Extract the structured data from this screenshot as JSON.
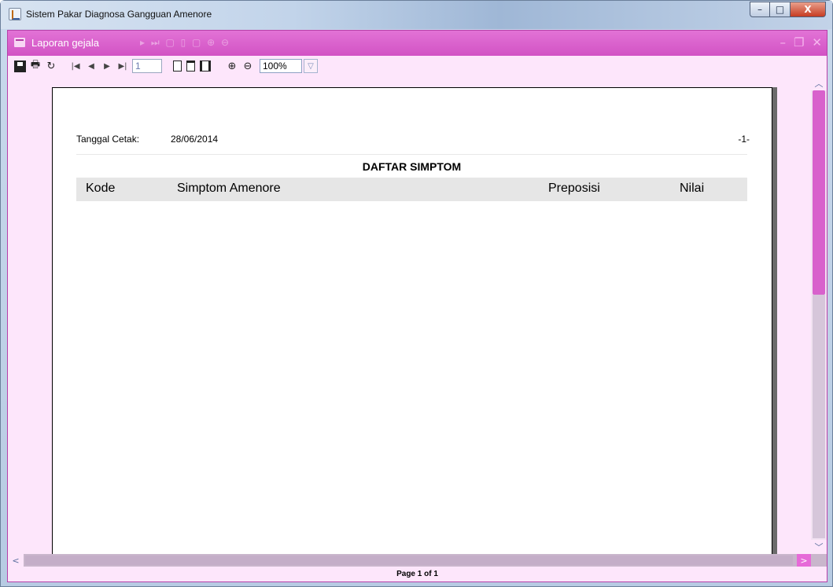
{
  "window": {
    "title": "Sistem Pakar Diagnosa Gangguan Amenore",
    "controls": {
      "minimize": "–",
      "maximize": "□",
      "close": "X"
    }
  },
  "internal_frame": {
    "title": "Laporan gejala",
    "controls": {
      "minimize": "–",
      "restore": "❐",
      "close": "✕"
    }
  },
  "toolbar": {
    "page_value": "1",
    "zoom_value": "100%",
    "icons": [
      "save-icon",
      "print-icon",
      "reload-icon",
      "first-page-icon",
      "prev-page-icon",
      "next-page-icon",
      "last-page-icon",
      "actual-size-icon",
      "fit-page-icon",
      "fit-width-icon",
      "zoom-in-icon",
      "zoom-out-icon"
    ]
  },
  "report": {
    "tanggal_label": "Tanggal Cetak:",
    "tanggal_value": "28/06/2014",
    "page_marker": "-1-",
    "title": "DAFTAR SIMPTOM",
    "columns": [
      "Kode",
      "Simptom Amenore",
      "Preposisi",
      "Nilai"
    ]
  },
  "status": {
    "page_text": "Page 1 of 1"
  },
  "colors": {
    "frame": "#e66ad8",
    "toolbar_bg": "#fde6fb",
    "thumb": "#d861cc"
  }
}
